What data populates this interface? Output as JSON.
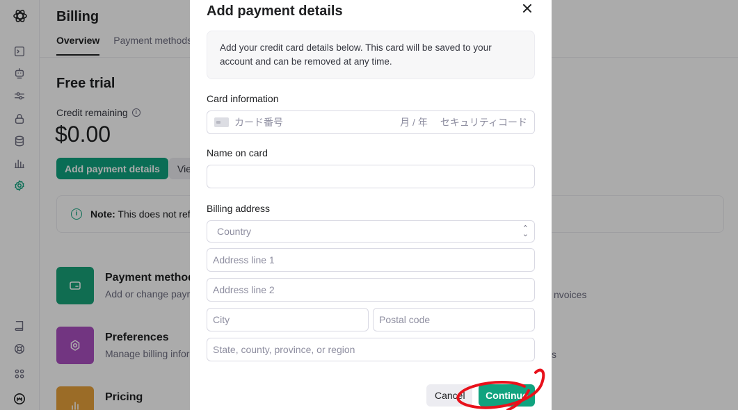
{
  "sidebar": {
    "icons": [
      "openai-logo-icon",
      "terminal-icon",
      "assistant-bot-icon",
      "sliders-icon",
      "lock-icon",
      "database-icon",
      "bar-chart-icon",
      "settings-gear-icon",
      "book-icon",
      "help-lifebuoy-icon",
      "apps-grid-icon",
      "user-avatar-icon"
    ],
    "active": "settings-gear-icon"
  },
  "page": {
    "title": "Billing",
    "tabs": [
      {
        "label": "Overview",
        "active": true
      },
      {
        "label": "Payment methods",
        "active": false
      }
    ]
  },
  "overview": {
    "plan_title": "Free trial",
    "credit_label": "Credit remaining",
    "credit_value": "$0.00",
    "add_payment_label": "Add payment details",
    "view_label": "Vie",
    "note_strong": "Note:",
    "note_text": "This does not ref"
  },
  "cards": [
    {
      "title": "Payment method",
      "desc": "Add or change payr",
      "color": "#19a37a",
      "icon": "credit-card-icon"
    },
    {
      "title": "Preferences",
      "desc": "Manage billing infor",
      "color": "#ab4fc0",
      "icon": "gear-icon"
    },
    {
      "title": "Pricing",
      "desc": "",
      "color": "#e8a23b",
      "icon": "bar-chart-icon"
    }
  ],
  "right_fragments": {
    "invoices": "nvoices",
    "s": "s"
  },
  "modal": {
    "title": "Add payment details",
    "info_text": "Add your credit card details below. This card will be saved to your account and can be removed at any time.",
    "card_label": "Card information",
    "card_number_placeholder": "カード番号",
    "card_expiry_placeholder": "月 / 年",
    "card_cvc_placeholder": "セキュリティコード",
    "name_label": "Name on card",
    "name_value": "",
    "billing_label": "Billing address",
    "country_placeholder": "Country",
    "address1_placeholder": "Address line 1",
    "address2_placeholder": "Address line 2",
    "city_placeholder": "City",
    "postal_placeholder": "Postal code",
    "state_placeholder": "State, county, province, or region",
    "cancel_label": "Cancel",
    "continue_label": "Continue"
  },
  "colors": {
    "accent": "#10a37f",
    "annotation": "#e8111b"
  }
}
